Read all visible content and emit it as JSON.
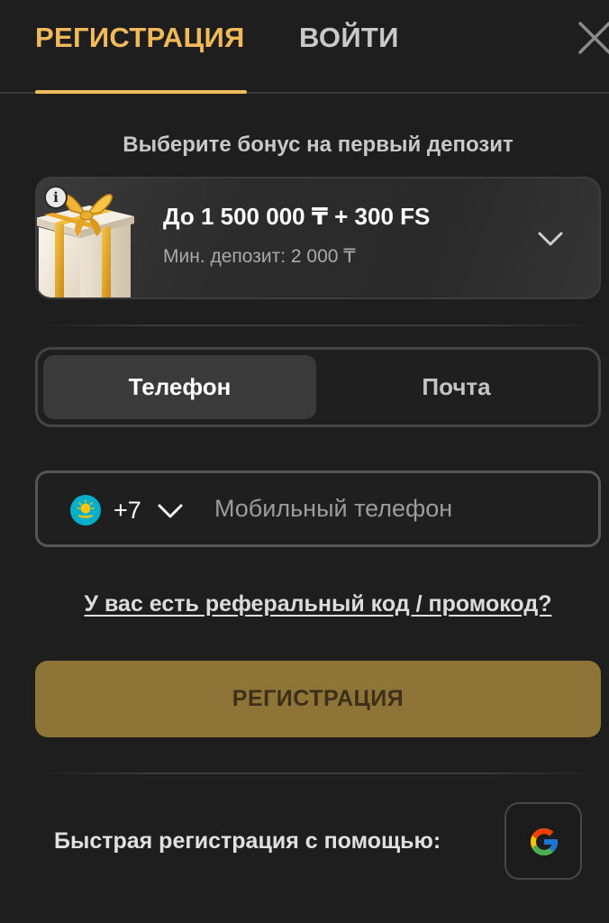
{
  "tabs": {
    "register": "РЕГИСТРАЦИЯ",
    "login": "ВОЙТИ",
    "active": "register"
  },
  "bonus": {
    "heading": "Выберите бонус на первый депозит",
    "title": "До 1 500 000 ₸ + 300 FS",
    "subtitle": "Мин. депозит: 2 000 ₸",
    "icons": [
      "info-icon",
      "gift-icon",
      "chevron-down-icon"
    ]
  },
  "method_switch": {
    "phone": "Телефон",
    "email": "Почта",
    "active": "phone"
  },
  "phone": {
    "country_code": "+7",
    "country_flag": "kazakhstan-flag-icon",
    "placeholder": "Мобильный телефон"
  },
  "promo_link": "У вас есть реферальный код / промокод?",
  "register_button": "РЕГИСТРАЦИЯ",
  "quick_register": {
    "label": "Быстрая регистрация с помощью:",
    "provider_icon": "google-icon"
  },
  "colors": {
    "background": "#1e1e1e",
    "accent": "#f0b95a",
    "button": "#8e7436",
    "flag_blue": "#00afca",
    "flag_gold": "#fec50c"
  }
}
